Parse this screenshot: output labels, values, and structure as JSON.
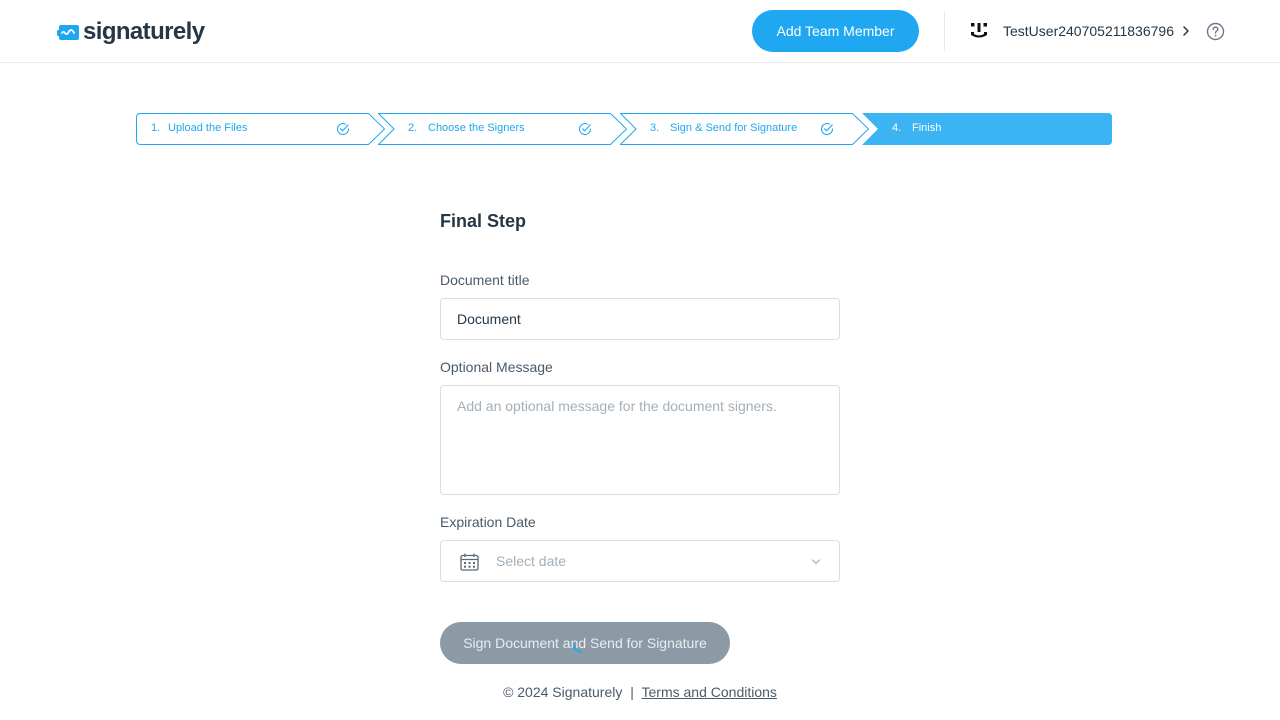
{
  "header": {
    "logo_text": "signaturely",
    "add_team_member_label": "Add Team Member",
    "user_name": "TestUser240705211836796"
  },
  "stepper": {
    "steps": [
      {
        "number": "1.",
        "label": "Upload the Files",
        "status": "completed"
      },
      {
        "number": "2.",
        "label": "Choose the Signers",
        "status": "completed"
      },
      {
        "number": "3.",
        "label": "Sign & Send for Signature",
        "status": "completed"
      },
      {
        "number": "4.",
        "label": "Finish",
        "status": "active"
      }
    ]
  },
  "form": {
    "title": "Final Step",
    "document_title_label": "Document title",
    "document_title_value": "Document",
    "optional_message_label": "Optional Message",
    "optional_message_placeholder": "Add an optional message for the document signers.",
    "optional_message_value": "",
    "expiration_date_label": "Expiration Date",
    "expiration_date_placeholder": "Select date",
    "submit_label": "Sign Document and Send for Signature"
  },
  "footer": {
    "copyright": "© 2024 Signaturely",
    "separator": "|",
    "terms_label": "Terms and Conditions"
  },
  "colors": {
    "accent": "#1fa8f1",
    "active_step": "#3cb4f3",
    "disabled_button": "#8c9aa5",
    "text": "#253746"
  },
  "icons": {
    "logo": "signaturely-logo-icon",
    "avatar": "user-avatar-icon",
    "chevron": "chevron-right-icon",
    "help": "question-circle-icon",
    "step_check": "check-circle-icon",
    "calendar": "calendar-icon",
    "dropdown": "chevron-down-icon",
    "loading": "spinner-icon"
  }
}
